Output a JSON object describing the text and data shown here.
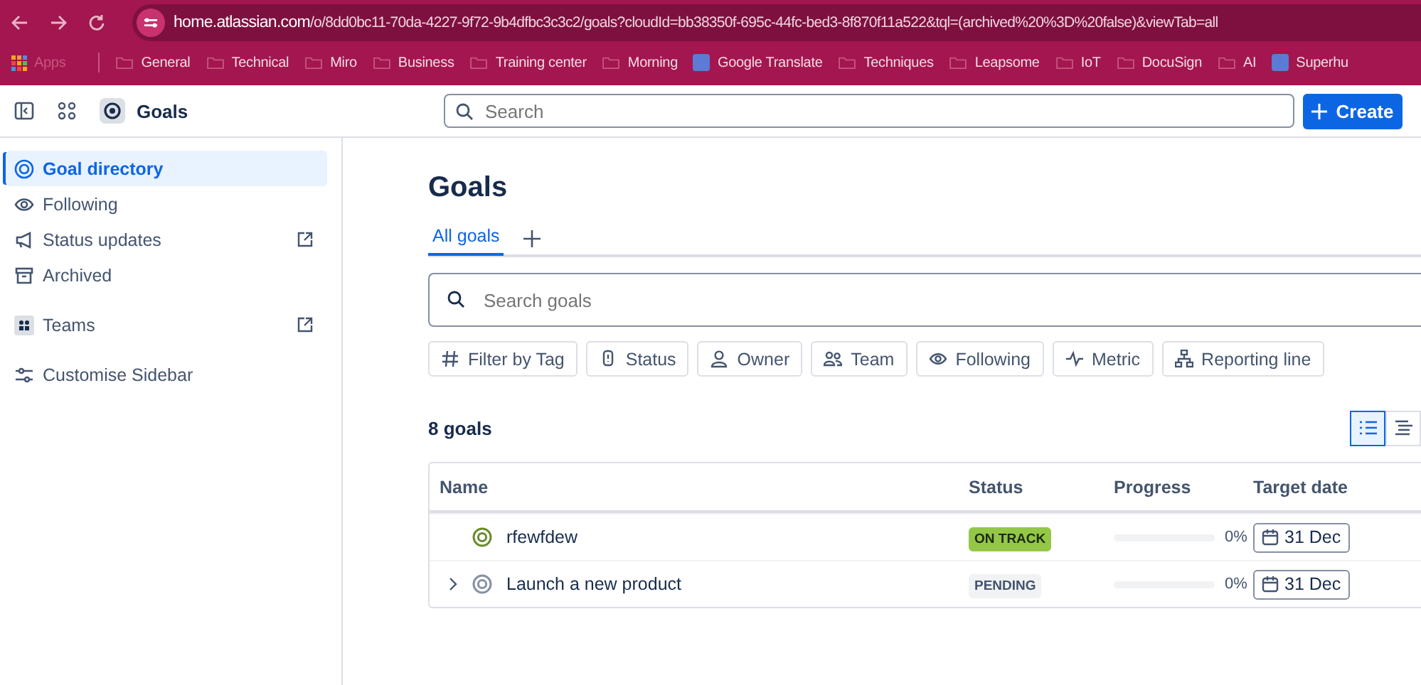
{
  "browser": {
    "url_host": "home.atlassian.com",
    "url_path": "/o/8dd0bc11-70da-4227-9f72-9b4dfbc3c3c2/goals?cloudId=bb38350f-695c-44fc-bed3-8f870f11a522&tql=(archived%20%3D%20false)&viewTab=all",
    "bookmarks": [
      {
        "label": "Apps",
        "kind": "apps"
      },
      {
        "label": "General",
        "kind": "folder"
      },
      {
        "label": "Technical",
        "kind": "folder"
      },
      {
        "label": "Miro",
        "kind": "folder"
      },
      {
        "label": "Business",
        "kind": "folder"
      },
      {
        "label": "Training center",
        "kind": "folder"
      },
      {
        "label": "Morning",
        "kind": "folder"
      },
      {
        "label": "Google Translate",
        "kind": "site"
      },
      {
        "label": "Techniques",
        "kind": "folder"
      },
      {
        "label": "Leapsome",
        "kind": "folder"
      },
      {
        "label": "IoT",
        "kind": "folder"
      },
      {
        "label": "DocuSign",
        "kind": "folder"
      },
      {
        "label": "AI",
        "kind": "folder"
      },
      {
        "label": "Superhu",
        "kind": "site"
      }
    ]
  },
  "header": {
    "app_name": "Goals",
    "search": {
      "placeholder": "Search"
    },
    "create_button": "Create"
  },
  "sidebar": {
    "items": [
      {
        "label": "Goal directory",
        "selected": true,
        "external": false
      },
      {
        "label": "Following",
        "selected": false,
        "external": false
      },
      {
        "label": "Status updates",
        "selected": false,
        "external": true
      },
      {
        "label": "Archived",
        "selected": false,
        "external": false
      },
      {
        "label": "Teams",
        "selected": false,
        "external": true
      },
      {
        "label": "Customise Sidebar",
        "selected": false,
        "external": false
      }
    ]
  },
  "page": {
    "title": "Goals",
    "tabs": [
      {
        "label": "All goals",
        "selected": true
      }
    ],
    "search": {
      "placeholder": "Search goals"
    },
    "filters": [
      {
        "label": "Filter by Tag"
      },
      {
        "label": "Status"
      },
      {
        "label": "Owner"
      },
      {
        "label": "Team"
      },
      {
        "label": "Following"
      },
      {
        "label": "Metric"
      },
      {
        "label": "Reporting line"
      }
    ],
    "count": "8 goals",
    "views": [
      {
        "kind": "list",
        "selected": true
      },
      {
        "kind": "tree",
        "selected": false
      }
    ],
    "table": {
      "columns": [
        "Name",
        "Status",
        "Progress",
        "Target date"
      ],
      "rows": [
        {
          "name": "rfewfdew",
          "expandable": false,
          "status": "ON TRACK",
          "color": "#94c748",
          "progress": "0%",
          "level": 0,
          "target_date": "31 Dec"
        },
        {
          "name": "Launch a new product",
          "expandable": true,
          "status": "PENDING",
          "color": "#f1f2f4",
          "progress": "0%",
          "level": 0,
          "target_date": "31 Dec"
        }
      ]
    }
  }
}
